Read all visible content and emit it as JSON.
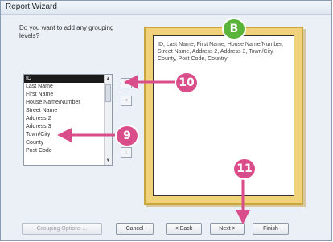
{
  "window": {
    "title": "Report Wizard"
  },
  "prompt": "Do you want to add any grouping levels?",
  "fields": [
    "ID",
    "Last Name",
    "First Name",
    "House Name/Number",
    "Street Name",
    "Address 2",
    "Address 3",
    "Town/City",
    "County",
    "Post Code"
  ],
  "arrow_buttons": {
    "add": ">",
    "remove": "<",
    "up": "↑",
    "down": "↓"
  },
  "preview": {
    "text": "ID, Last Name, First Name, House Name/Number, Street Name, Address 2, Address 3, Town/City, County, Post Code, Country"
  },
  "buttons": {
    "grouping_options": "Grouping Options ...",
    "cancel": "Cancel",
    "back": "< Back",
    "next": "Next >",
    "finish": "Finish"
  },
  "callouts": {
    "b": "B",
    "ten": "10",
    "nine": "9",
    "eleven": "11"
  },
  "colors": {
    "callout": "#d94e8a",
    "callout_green": "#5ab33b",
    "preview_frame": "#f0d27a"
  }
}
